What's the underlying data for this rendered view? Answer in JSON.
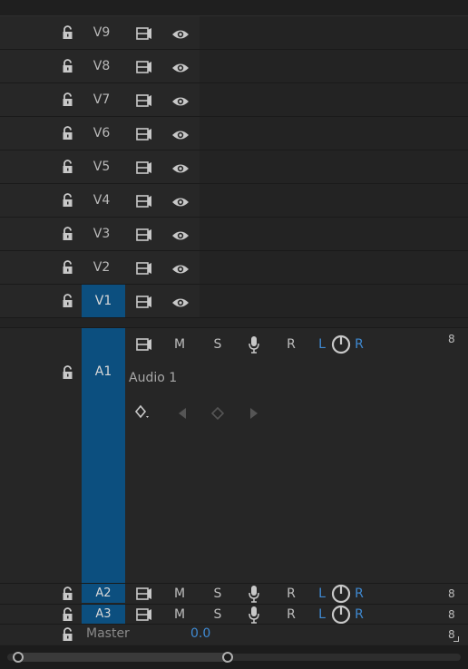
{
  "video_tracks": [
    {
      "name": "V9"
    },
    {
      "name": "V8"
    },
    {
      "name": "V7"
    },
    {
      "name": "V6"
    },
    {
      "name": "V5"
    },
    {
      "name": "V4"
    },
    {
      "name": "V3"
    },
    {
      "name": "V2"
    },
    {
      "name": "V1",
      "selected": true
    }
  ],
  "audio_tracks": [
    {
      "name": "A1",
      "label": "Audio 1",
      "m": "M",
      "s": "S",
      "r": "R",
      "pan_l": "L",
      "pan_r": "R",
      "meter": "8"
    },
    {
      "name": "A2",
      "m": "M",
      "s": "S",
      "r": "R",
      "pan_l": "L",
      "pan_r": "R",
      "meter": "8"
    },
    {
      "name": "A3",
      "m": "M",
      "s": "S",
      "r": "R",
      "pan_l": "L",
      "pan_r": "R",
      "meter": "8"
    }
  ],
  "master": {
    "label": "Master",
    "value": "0.0",
    "meter": "8"
  },
  "icons": [
    "lock-icon",
    "sync-lock-icon",
    "eye-icon",
    "mic-icon",
    "pan-knob-icon",
    "keyframe-add-icon",
    "prev-keyframe-icon",
    "next-keyframe-icon"
  ],
  "colors": {
    "accent": "#3f8ad3",
    "selected_track": "#0c4f7f",
    "background": "#232323"
  }
}
